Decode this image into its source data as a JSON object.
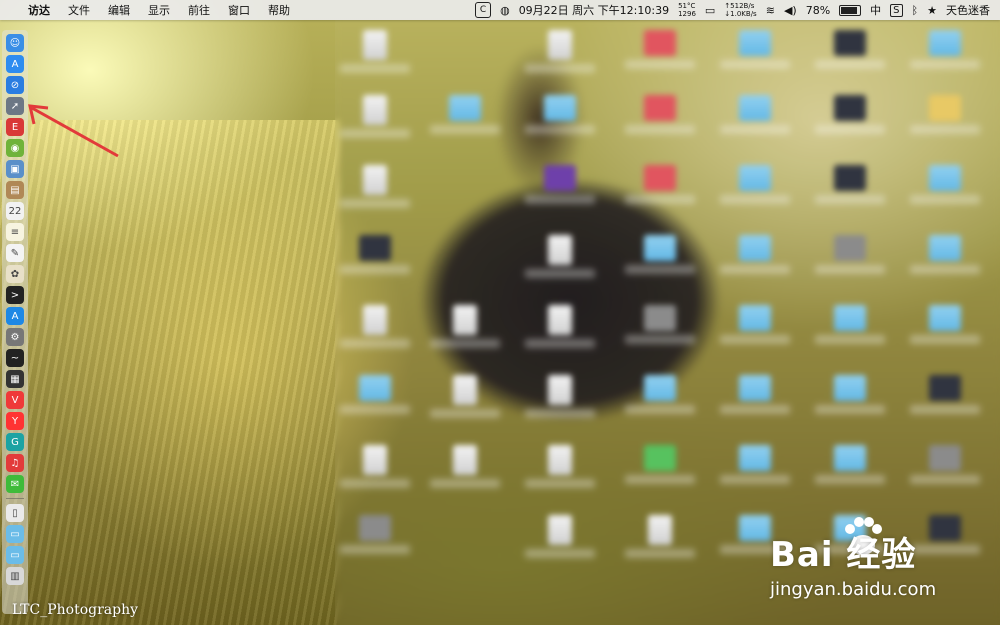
{
  "menubar": {
    "apple_glyph": "",
    "app_name": "访达",
    "menus": [
      "文件",
      "编辑",
      "显示",
      "前往",
      "窗口",
      "帮助"
    ],
    "status": {
      "c_icon": "C",
      "date_time": "09月22日 周六 下午12:10:39",
      "cpu_temp": "51°C",
      "fan": "1296",
      "net_up": "↑512B/s",
      "net_down": "↓1.0KB/s",
      "battery_pct": "78%",
      "ime": "中",
      "s_icon": "S",
      "user": "天色迷香"
    }
  },
  "dock": {
    "apps": [
      {
        "name": "finder-icon",
        "color": "#3a8ee6",
        "glyph": "☺"
      },
      {
        "name": "app-store-icon",
        "color": "#2d8cf0",
        "glyph": "A"
      },
      {
        "name": "safari-icon",
        "color": "#2a7de1",
        "glyph": "⊘"
      },
      {
        "name": "launchpad-icon",
        "color": "#6c7785",
        "glyph": "➚"
      },
      {
        "name": "app-red-icon",
        "color": "#d93838",
        "glyph": "E"
      },
      {
        "name": "android-icon",
        "color": "#6fb33a",
        "glyph": "◉"
      },
      {
        "name": "preview-icon",
        "color": "#5a8fc9",
        "glyph": "▣"
      },
      {
        "name": "notes-brown-icon",
        "color": "#b08856",
        "glyph": "▤"
      },
      {
        "name": "calendar-icon",
        "color": "#f2f2f2",
        "glyph": "22"
      },
      {
        "name": "notes-icon",
        "color": "#f7f4e0",
        "glyph": "≡"
      },
      {
        "name": "textedit-icon",
        "color": "#f4f4f4",
        "glyph": "✎"
      },
      {
        "name": "photos-icon",
        "color": "#e8e0c8",
        "glyph": "✿"
      },
      {
        "name": "terminal-icon",
        "color": "#222",
        "glyph": ">"
      },
      {
        "name": "app-store-blue-icon",
        "color": "#1e88e5",
        "glyph": "A"
      },
      {
        "name": "system-preferences-icon",
        "color": "#777",
        "glyph": "⚙"
      },
      {
        "name": "activity-monitor-icon",
        "color": "#222",
        "glyph": "~"
      },
      {
        "name": "console-icon",
        "color": "#333",
        "glyph": "▦"
      },
      {
        "name": "vivaldi-icon",
        "color": "#ef3939",
        "glyph": "V"
      },
      {
        "name": "yandex-icon",
        "color": "#ff3333",
        "glyph": "Y"
      },
      {
        "name": "app-teal-icon",
        "color": "#1ca3a3",
        "glyph": "G"
      },
      {
        "name": "netease-music-icon",
        "color": "#e23b3b",
        "glyph": "♫"
      },
      {
        "name": "wechat-icon",
        "color": "#3fbb3a",
        "glyph": "✉"
      }
    ],
    "stack": [
      {
        "name": "document-stack-icon",
        "color": "#eaeaea",
        "glyph": "▯"
      },
      {
        "name": "folder-stack-icon",
        "color": "#6bbce8",
        "glyph": "▭"
      },
      {
        "name": "folder-downloads-icon",
        "color": "#6bbce8",
        "glyph": "▭"
      },
      {
        "name": "trash-icon",
        "color": "#d8d8d8",
        "glyph": "▥"
      }
    ]
  },
  "watermarks": {
    "photo_credit": "LTC_Photography",
    "baidu_brand": "Bai 经验",
    "baidu_url": "jingyan.baidu.com"
  },
  "colors": {
    "annotation_arrow": "#e23a3a",
    "menubar_bg": "#ebebeb"
  }
}
